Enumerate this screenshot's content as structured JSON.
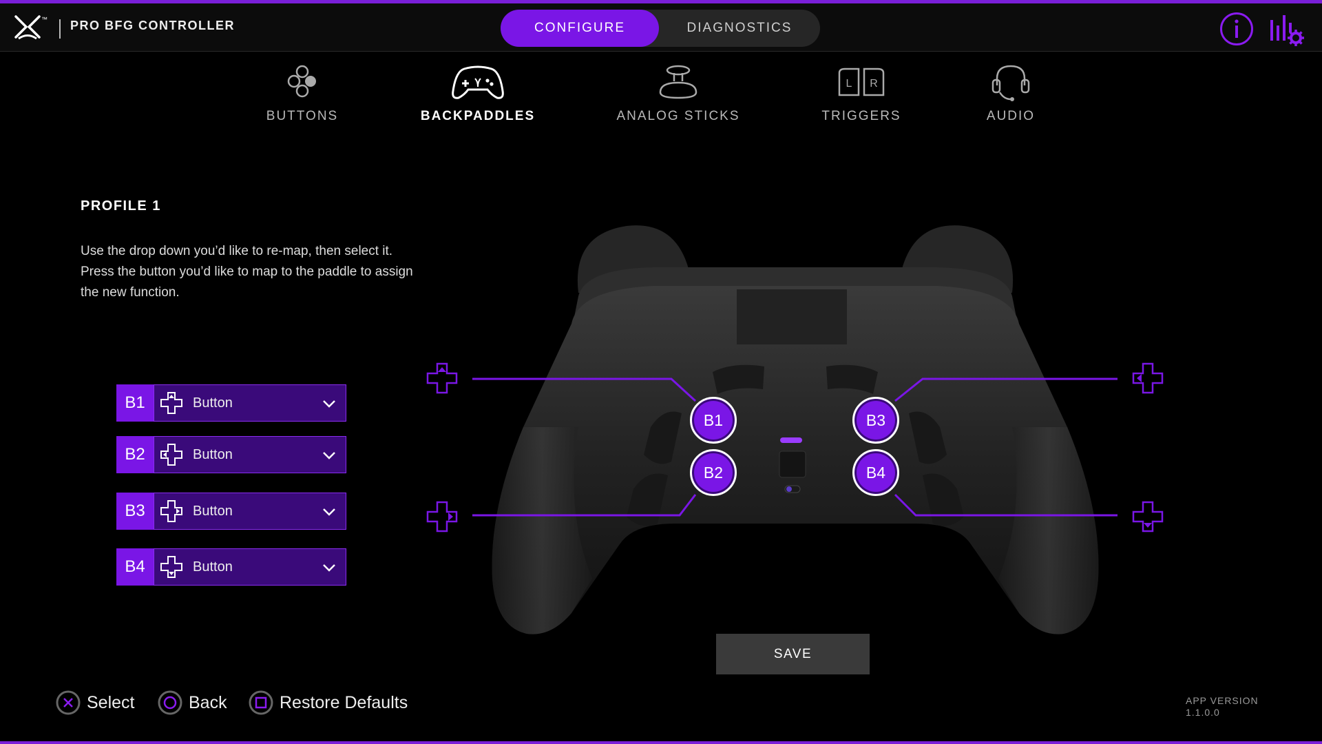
{
  "app": {
    "title": "PRO BFG CONTROLLER",
    "logo_mark": "™"
  },
  "mode_toggle": {
    "configure": "CONFIGURE",
    "diagnostics": "DIAGNOSTICS",
    "active": "CONFIGURE"
  },
  "header_icons": [
    "info-icon",
    "settings-icon"
  ],
  "nav": {
    "active": "BACKPADDLES",
    "items": [
      {
        "label": "BUTTONS",
        "icon": "buttons-icon"
      },
      {
        "label": "BACKPADDLES",
        "icon": "gamepad-icon"
      },
      {
        "label": "ANALOG STICKS",
        "icon": "analog-stick-icon"
      },
      {
        "label": "TRIGGERS",
        "icon": "triggers-icon"
      },
      {
        "label": "AUDIO",
        "icon": "headset-icon"
      }
    ]
  },
  "profile": {
    "title": "PROFILE 1",
    "instructions": "Use the drop down you’d like to re-map, then select it. Press the button you’d like to map to the paddle to assign the new function."
  },
  "mappings": [
    {
      "paddle": "B1",
      "value": "Button"
    },
    {
      "paddle": "B2",
      "value": "Button"
    },
    {
      "paddle": "B3",
      "value": "Button"
    },
    {
      "paddle": "B4",
      "value": "Button"
    }
  ],
  "controller": {
    "markers": [
      "B1",
      "B2",
      "B3",
      "B4"
    ]
  },
  "save_label": "SAVE",
  "footer": {
    "hints": [
      {
        "label": "Select",
        "icon": "cross-button-icon"
      },
      {
        "label": "Back",
        "icon": "circle-button-icon"
      },
      {
        "label": "Restore Defaults",
        "icon": "square-button-icon"
      }
    ],
    "version_label": "APP VERSION",
    "version_number": "1.1.0.0"
  },
  "colors": {
    "accent": "#7a16e6",
    "accent_dark": "#3a0a7a",
    "background": "#000000",
    "header_bg": "#0c0c0c"
  }
}
